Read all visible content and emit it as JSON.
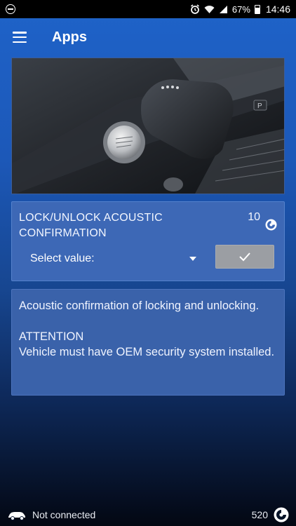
{
  "status_bar": {
    "battery": "67%",
    "time": "14:46",
    "icons": [
      "do-not-disturb-icon",
      "alarm-icon",
      "wifi-icon",
      "signal-icon",
      "battery-icon"
    ]
  },
  "app_bar": {
    "title": "Apps",
    "menu_icon": "hamburger-menu-icon"
  },
  "hero_image": {
    "subject": "car-key-and-start-button-photo"
  },
  "setting_card": {
    "title": "LOCK/UNLOCK ACOUSTIC CONFIRMATION",
    "value": "10",
    "value_icon": "coin-icon",
    "select_label": "Select value:",
    "confirm_icon": "checkmark-icon"
  },
  "description_card": {
    "text": "Acoustic confirmation of locking and unlocking.\n\nATTENTION\nVehicle must have OEM security system installed."
  },
  "footer": {
    "connection_icon": "car-icon",
    "connection_status": "Not connected",
    "balance": "520",
    "balance_icon": "coin-icon"
  },
  "colors": {
    "primary": "#1f63c9",
    "card": "#3d68b6",
    "button_disabled": "#9b9ea3"
  }
}
